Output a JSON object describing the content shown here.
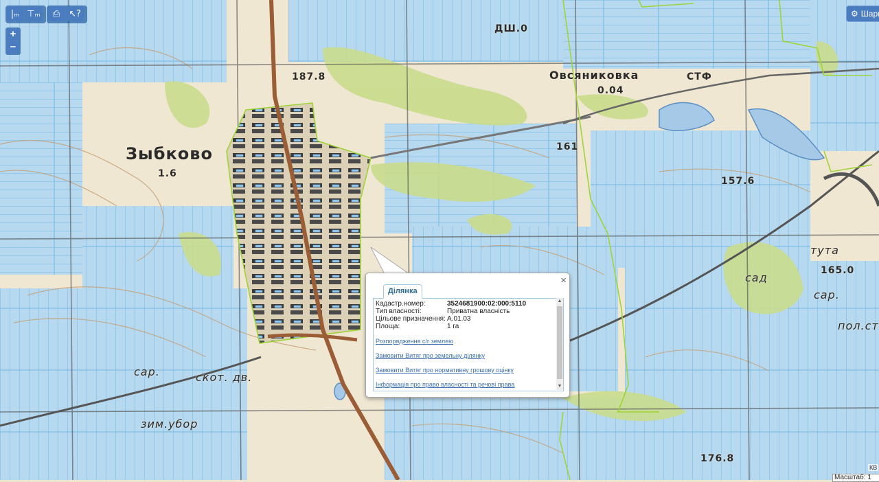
{
  "toolbar": {
    "measure_length_icon": "ruler-length-icon",
    "measure_area_icon": "ruler-area-icon",
    "print_icon": "printer-icon",
    "identify_icon": "pointer-question-icon",
    "measure_length_glyph": "|ₘ",
    "measure_area_glyph": "⊤ₘ",
    "print_glyph": "⎙",
    "identify_glyph": "↖?"
  },
  "zoom": {
    "in": "+",
    "out": "−"
  },
  "layers": {
    "label": "Шари",
    "icon": "gear-icon",
    "glyph": "⚙"
  },
  "map_labels": {
    "village": "Зыбково",
    "village2": "Овсяниковка",
    "height1": "1.6",
    "height2": "187.8",
    "height3": "157.6",
    "height4": "161",
    "height5": "165.0",
    "height6": "176.8",
    "height7": "ДШ.0",
    "sto": "СТФ",
    "sar1": "сар.",
    "sar2": "сар.",
    "sar3": "сад",
    "skot": "скот. дв.",
    "zim": "зим.убор",
    "tuta": "тута",
    "pol": "пол.ст.",
    "num": "0.04"
  },
  "popup": {
    "tab": "Ділянка",
    "close": "×",
    "fields": [
      {
        "key": "Кадастр.номер:",
        "value": "3524681900:02:000:5110",
        "bold": true
      },
      {
        "key": "Тип власності:",
        "value": "Приватна власність",
        "bold": false
      },
      {
        "key": "Цільове призначення:",
        "value": "A.01.03",
        "bold": false
      },
      {
        "key": "Площа:",
        "value": "1 га",
        "bold": false
      }
    ],
    "links": [
      "Розпорядження с/г землею",
      "Замовити Витяг про земельну ділянку",
      "Замовити Витяг про нормативну грошову оцінку",
      "Інформація про право власності та речові права"
    ]
  },
  "scale": {
    "label": "Масштаб: 1",
    "tag": "КВ"
  },
  "colors": {
    "parcel_fill": "#a9d0ee",
    "parcel_line": "#68b6e6",
    "green_boundary": "#9ed43a",
    "road": "#9a5d36",
    "forest": "#c9dc8c",
    "map_bg": "#efe7d2"
  }
}
